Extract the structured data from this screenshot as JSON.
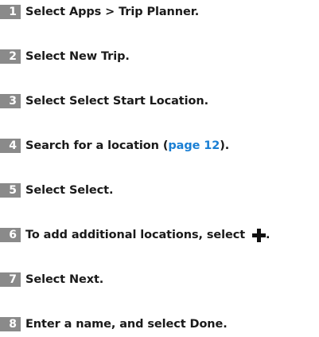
{
  "steps": [
    {
      "number": "1",
      "text": "Select Apps > Trip Planner."
    },
    {
      "number": "2",
      "text": "Select New Trip."
    },
    {
      "number": "3",
      "text": "Select Select Start Location."
    },
    {
      "number": "4",
      "text_before": "Search for a location (",
      "link": "page 12",
      "text_after": ")."
    },
    {
      "number": "5",
      "text": "Select Select."
    },
    {
      "number": "6",
      "text_before": "To add additional locations, select ",
      "icon": "plus-icon",
      "text_after": "."
    },
    {
      "number": "7",
      "text": "Select Next."
    },
    {
      "number": "8",
      "text": "Enter a name, and select Done."
    }
  ],
  "colors": {
    "step_number_bg": "#8a8a8a",
    "link": "#1a7fd4",
    "text": "#1a1a1a"
  }
}
